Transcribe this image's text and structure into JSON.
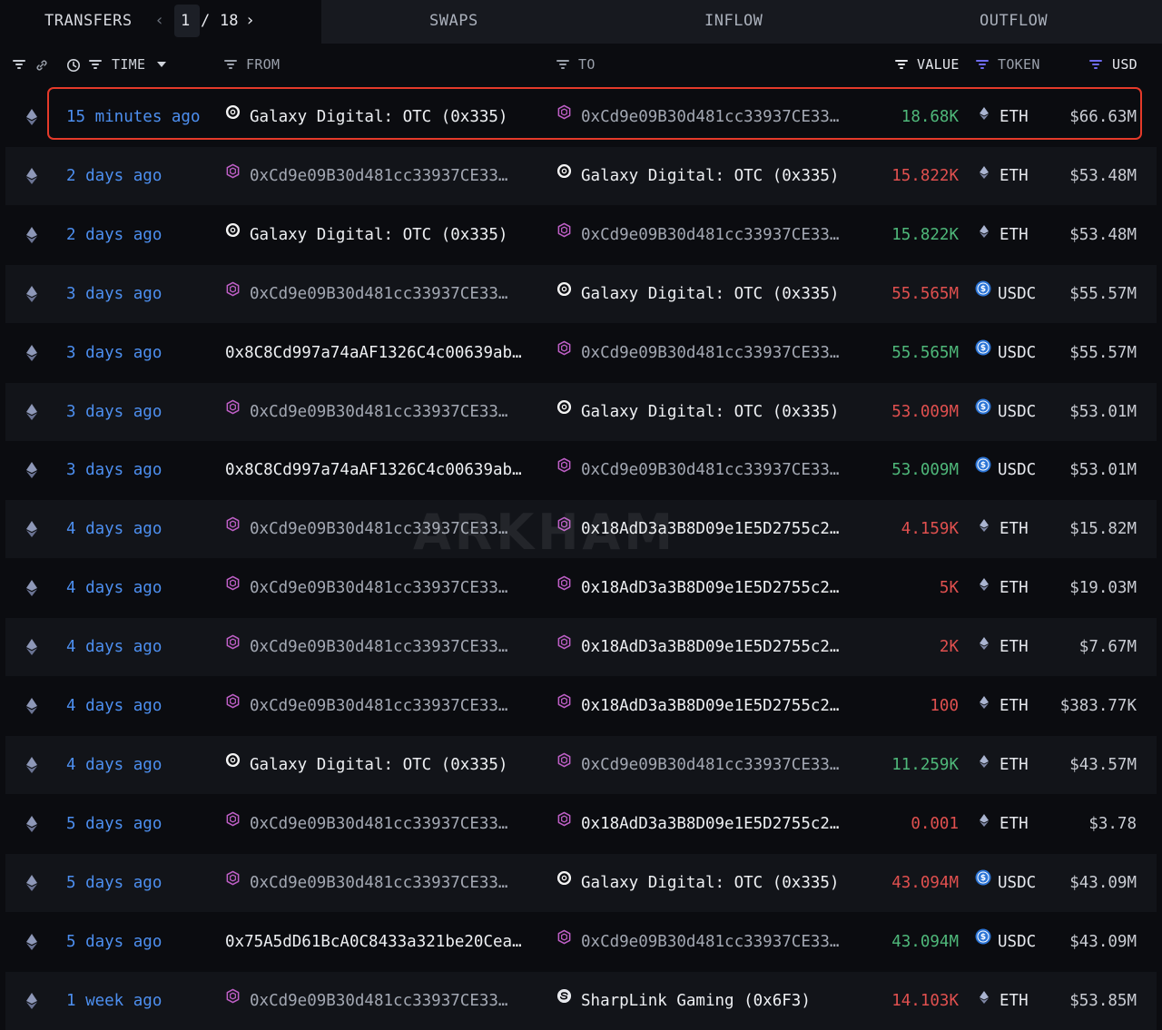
{
  "tabs": {
    "transfers": "TRANSFERS",
    "page_current": "1",
    "page_sep": "/",
    "page_total": "18",
    "swaps": "SWAPS",
    "inflow": "INFLOW",
    "outflow": "OUTFLOW"
  },
  "columns": {
    "time": "TIME",
    "from": "FROM",
    "to": "TO",
    "value": "VALUE",
    "token": "TOKEN",
    "usd": "USD"
  },
  "watermark": "ARKHAM",
  "colors": {
    "accent_link": "#4d8ff0",
    "inflow_green": "#4fb87a",
    "outflow_red": "#e0504f",
    "highlight_border": "#e53a2a"
  },
  "rows": [
    {
      "time": "15 minutes ago",
      "from": "Galaxy Digital: OTC (0x335)",
      "from_icon": "galaxy-icon",
      "to": "0xCd9e09B30d481cc33937CE33…",
      "to_icon": "contract-icon",
      "value": "18.68K",
      "direction": "in",
      "token": "ETH",
      "usd": "$66.63M",
      "highlighted": true
    },
    {
      "time": "2 days ago",
      "from": "0xCd9e09B30d481cc33937CE33…",
      "from_icon": "contract-icon",
      "to": "Galaxy Digital: OTC (0x335)",
      "to_icon": "galaxy-icon",
      "value": "15.822K",
      "direction": "out",
      "token": "ETH",
      "usd": "$53.48M"
    },
    {
      "time": "2 days ago",
      "from": "Galaxy Digital: OTC (0x335)",
      "from_icon": "galaxy-icon",
      "to": "0xCd9e09B30d481cc33937CE33…",
      "to_icon": "contract-icon",
      "value": "15.822K",
      "direction": "in",
      "token": "ETH",
      "usd": "$53.48M"
    },
    {
      "time": "3 days ago",
      "from": "0xCd9e09B30d481cc33937CE33…",
      "from_icon": "contract-icon",
      "to": "Galaxy Digital: OTC (0x335)",
      "to_icon": "galaxy-icon",
      "value": "55.565M",
      "direction": "out",
      "token": "USDC",
      "usd": "$55.57M"
    },
    {
      "time": "3 days ago",
      "from": "0x8C8Cd997a74aAF1326C4c00639ab…",
      "from_icon": "",
      "to": "0xCd9e09B30d481cc33937CE33…",
      "to_icon": "contract-icon",
      "value": "55.565M",
      "direction": "in",
      "token": "USDC",
      "usd": "$55.57M"
    },
    {
      "time": "3 days ago",
      "from": "0xCd9e09B30d481cc33937CE33…",
      "from_icon": "contract-icon",
      "to": "Galaxy Digital: OTC (0x335)",
      "to_icon": "galaxy-icon",
      "value": "53.009M",
      "direction": "out",
      "token": "USDC",
      "usd": "$53.01M"
    },
    {
      "time": "3 days ago",
      "from": "0x8C8Cd997a74aAF1326C4c00639ab…",
      "from_icon": "",
      "to": "0xCd9e09B30d481cc33937CE33…",
      "to_icon": "contract-icon",
      "value": "53.009M",
      "direction": "in",
      "token": "USDC",
      "usd": "$53.01M"
    },
    {
      "time": "4 days ago",
      "from": "0xCd9e09B30d481cc33937CE33…",
      "from_icon": "contract-icon",
      "to": "0x18AdD3a3B8D09e1E5D2755c2…",
      "to_icon": "contract-icon",
      "value": "4.159K",
      "direction": "out",
      "token": "ETH",
      "usd": "$15.82M"
    },
    {
      "time": "4 days ago",
      "from": "0xCd9e09B30d481cc33937CE33…",
      "from_icon": "contract-icon",
      "to": "0x18AdD3a3B8D09e1E5D2755c2…",
      "to_icon": "contract-icon",
      "value": "5K",
      "direction": "out",
      "token": "ETH",
      "usd": "$19.03M"
    },
    {
      "time": "4 days ago",
      "from": "0xCd9e09B30d481cc33937CE33…",
      "from_icon": "contract-icon",
      "to": "0x18AdD3a3B8D09e1E5D2755c2…",
      "to_icon": "contract-icon",
      "value": "2K",
      "direction": "out",
      "token": "ETH",
      "usd": "$7.67M"
    },
    {
      "time": "4 days ago",
      "from": "0xCd9e09B30d481cc33937CE33…",
      "from_icon": "contract-icon",
      "to": "0x18AdD3a3B8D09e1E5D2755c2…",
      "to_icon": "contract-icon",
      "value": "100",
      "direction": "out",
      "token": "ETH",
      "usd": "$383.77K"
    },
    {
      "time": "4 days ago",
      "from": "Galaxy Digital: OTC (0x335)",
      "from_icon": "galaxy-icon",
      "to": "0xCd9e09B30d481cc33937CE33…",
      "to_icon": "contract-icon",
      "value": "11.259K",
      "direction": "in",
      "token": "ETH",
      "usd": "$43.57M"
    },
    {
      "time": "5 days ago",
      "from": "0xCd9e09B30d481cc33937CE33…",
      "from_icon": "contract-icon",
      "to": "0x18AdD3a3B8D09e1E5D2755c2…",
      "to_icon": "contract-icon",
      "value": "0.001",
      "direction": "out",
      "token": "ETH",
      "usd": "$3.78"
    },
    {
      "time": "5 days ago",
      "from": "0xCd9e09B30d481cc33937CE33…",
      "from_icon": "contract-icon",
      "to": "Galaxy Digital: OTC (0x335)",
      "to_icon": "galaxy-icon",
      "value": "43.094M",
      "direction": "out",
      "token": "USDC",
      "usd": "$43.09M"
    },
    {
      "time": "5 days ago",
      "from": "0x75A5dD61BcA0C8433a321be20Cea…",
      "from_icon": "",
      "to": "0xCd9e09B30d481cc33937CE33…",
      "to_icon": "contract-icon",
      "value": "43.094M",
      "direction": "in",
      "token": "USDC",
      "usd": "$43.09M"
    },
    {
      "time": "1 week ago",
      "from": "0xCd9e09B30d481cc33937CE33…",
      "from_icon": "contract-icon",
      "to": "SharpLink Gaming (0x6F3)",
      "to_icon": "sharplink-icon",
      "value": "14.103K",
      "direction": "out",
      "token": "ETH",
      "usd": "$53.85M"
    }
  ]
}
